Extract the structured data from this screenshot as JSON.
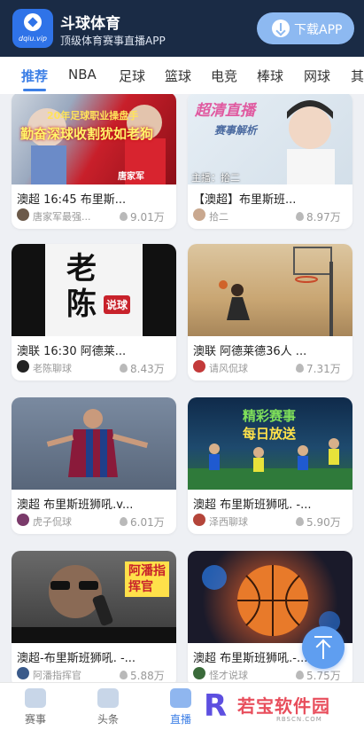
{
  "header": {
    "logo_url": "dqiu.vip",
    "app_name": "斗球体育",
    "slogan": "顶级体育赛事直播APP",
    "download_label": "下载APP"
  },
  "tabs": [
    "推荐",
    "NBA",
    "足球",
    "篮球",
    "电竞",
    "棒球",
    "网球",
    "其"
  ],
  "cards": [
    {
      "title": "澳超 16:45 布里斯...",
      "author": "唐家军最强...",
      "views": "9.01万",
      "overlay": [
        "20年足球职业操盘手",
        "勤奋深球收割犹如老狗",
        "唐家军"
      ]
    },
    {
      "title": "【澳超】布里斯班...",
      "author": "拾二",
      "views": "8.97万",
      "overlay": [
        "超清直播",
        "赛事解析",
        "主播：拾二"
      ]
    },
    {
      "title": "澳联 16:30 阿德莱...",
      "author": "老陈聊球",
      "views": "8.43万",
      "overlay": [
        "老陈",
        "说球"
      ]
    },
    {
      "title": "澳联 阿德莱德36人 ...",
      "author": "请风侃球",
      "views": "7.31万",
      "overlay": []
    },
    {
      "title": "澳超 布里斯班狮吼.v...",
      "author": "虎子侃球",
      "views": "6.01万",
      "overlay": []
    },
    {
      "title": "澳超 布里斯班狮吼. -...",
      "author": "泽西聊球",
      "views": "5.90万",
      "overlay": [
        "精彩赛事",
        "每日放送"
      ]
    },
    {
      "title": "澳超-布里斯班狮吼. -...",
      "author": "阿潘指挥官",
      "views": "5.88万",
      "overlay": [
        "阿潘指",
        "挥官"
      ]
    },
    {
      "title": "澳超 布里斯班狮吼.-...",
      "author": "怪才说球",
      "views": "5.75万",
      "overlay": []
    }
  ],
  "tabbar": [
    "赛事",
    "头条",
    "直播"
  ],
  "watermark": {
    "mark": "R",
    "text": "若宝软件园",
    "sub": "RBSCN.COM"
  },
  "colors": {
    "accent": "#3d7fe6",
    "header_bg": "#1a2b45"
  },
  "icons": [
    "logo-icon",
    "download-icon",
    "fire-icon",
    "scroll-top-icon",
    "events-tab-icon",
    "news-tab-icon",
    "live-tab-icon"
  ]
}
